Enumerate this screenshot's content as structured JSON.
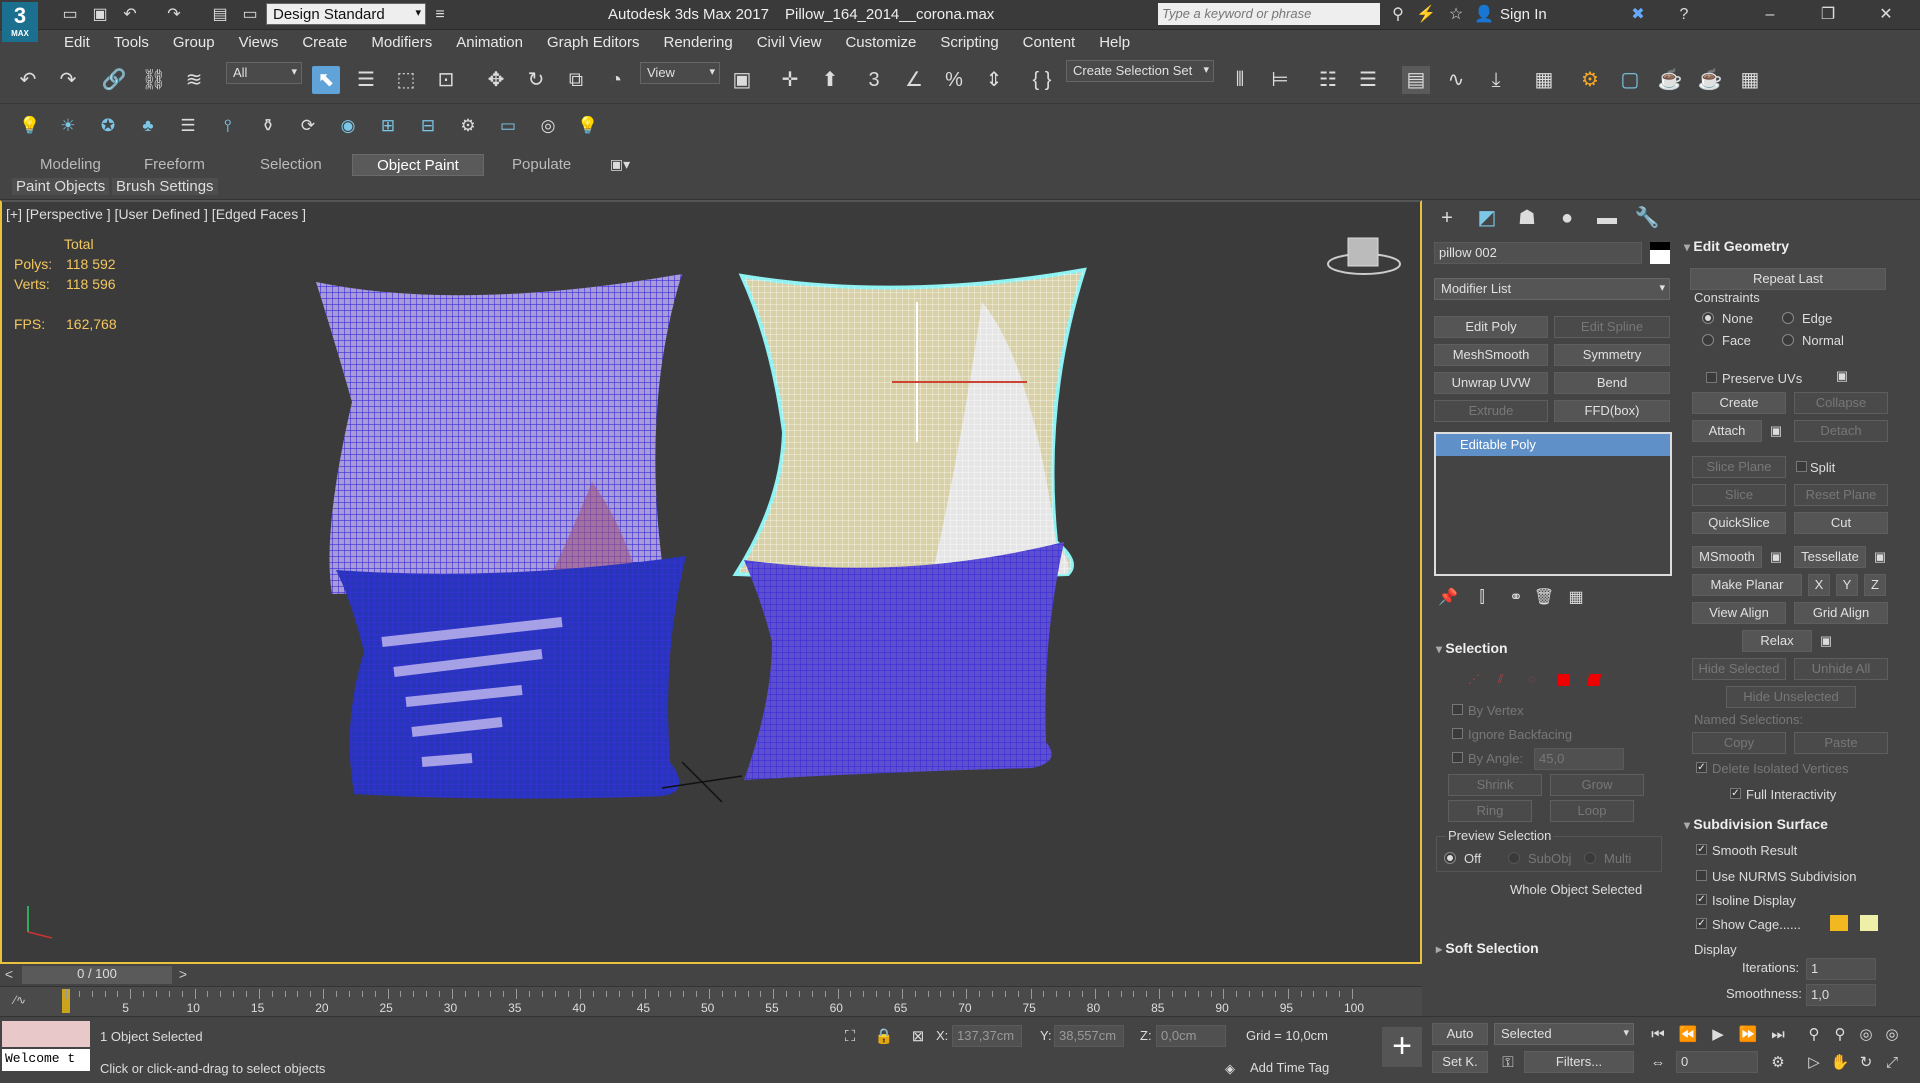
{
  "title_bar": {
    "workspace": "Design Standard",
    "app_title": "Autodesk 3ds Max 2017",
    "file": "Pillow_164_2014__corona.max",
    "search_placeholder": "Type a keyword or phrase",
    "sign_in": "Sign In"
  },
  "menu": [
    "Edit",
    "Tools",
    "Group",
    "Views",
    "Create",
    "Modifiers",
    "Animation",
    "Graph Editors",
    "Rendering",
    "Civil View",
    "Customize",
    "Scripting",
    "Content",
    "Help"
  ],
  "toolbar": {
    "filter": "All",
    "ref_coord": "View",
    "selection_set": "Create Selection Set"
  },
  "ribbon": {
    "tabs": [
      "Modeling",
      "Freeform",
      "Selection",
      "Object Paint",
      "Populate"
    ],
    "active": "Object Paint",
    "subtabs": [
      "Paint Objects",
      "Brush Settings"
    ]
  },
  "viewport": {
    "label": "[+] [Perspective ] [User Defined ] [Edged Faces ]",
    "total": "Total",
    "polys_label": "Polys:",
    "polys": "118 592",
    "verts_label": "Verts:",
    "verts": "118 596",
    "fps_label": "FPS:",
    "fps": "162,768"
  },
  "command_panel": {
    "object_name": "pillow 002",
    "modifier_list": "Modifier List",
    "modifier_buttons": [
      "Edit Poly",
      "Edit Spline",
      "MeshSmooth",
      "Symmetry",
      "Unwrap UVW",
      "Bend",
      "Extrude",
      "FFD(box)"
    ],
    "stack_item": "Editable Poly",
    "selection": {
      "title": "Selection",
      "by_vertex": "By Vertex",
      "ignore_backfacing": "Ignore Backfacing",
      "by_angle": "By Angle:",
      "angle": "45,0",
      "shrink": "Shrink",
      "grow": "Grow",
      "ring": "Ring",
      "loop": "Loop",
      "preview": "Preview Selection",
      "off": "Off",
      "subobj": "SubObj",
      "multi": "Multi",
      "whole": "Whole Object Selected"
    },
    "soft_selection": "Soft Selection"
  },
  "edit_geometry": {
    "title": "Edit Geometry",
    "repeat_last": "Repeat Last",
    "constraints": "Constraints",
    "none": "None",
    "edge": "Edge",
    "face": "Face",
    "normal": "Normal",
    "preserve_uvs": "Preserve UVs",
    "create": "Create",
    "collapse": "Collapse",
    "attach": "Attach",
    "detach": "Detach",
    "slice_plane": "Slice Plane",
    "split": "Split",
    "slice": "Slice",
    "reset_plane": "Reset Plane",
    "quickslice": "QuickSlice",
    "cut": "Cut",
    "msmooth": "MSmooth",
    "tessellate": "Tessellate",
    "make_planar": "Make Planar",
    "x": "X",
    "y": "Y",
    "z": "Z",
    "view_align": "View Align",
    "grid_align": "Grid Align",
    "relax": "Relax",
    "hide_selected": "Hide Selected",
    "unhide_all": "Unhide All",
    "hide_unselected": "Hide Unselected",
    "named_selections": "Named Selections:",
    "copy": "Copy",
    "paste": "Paste",
    "delete_isolated": "Delete Isolated Vertices",
    "full_interactivity": "Full Interactivity"
  },
  "subdivision": {
    "title": "Subdivision Surface",
    "smooth_result": "Smooth Result",
    "use_nurms": "Use NURMS Subdivision",
    "isoline": "Isoline Display",
    "show_cage": "Show Cage......",
    "display": "Display",
    "iterations_label": "Iterations:",
    "iterations": "1",
    "smoothness_label": "Smoothness:",
    "smoothness": "1,0"
  },
  "timeline": {
    "frame": "0 / 100",
    "ticks": [
      "0",
      "5",
      "10",
      "15",
      "20",
      "25",
      "30",
      "35",
      "40",
      "45",
      "50",
      "55",
      "60",
      "65",
      "70",
      "75",
      "80",
      "85",
      "90",
      "95",
      "100"
    ]
  },
  "status": {
    "welcome": "Welcome t",
    "selected": "1 Object Selected",
    "hint": "Click or click-and-drag to select objects",
    "x_label": "X:",
    "x": "137,37cm",
    "y_label": "Y:",
    "y": "38,557cm",
    "z_label": "Z:",
    "z": "0,0cm",
    "grid": "Grid = 10,0cm",
    "add_time_tag": "Add Time Tag",
    "auto": "Auto",
    "set_key": "Set K.",
    "selected_dd": "Selected",
    "filters": "Filters...",
    "frame_field": "0"
  }
}
